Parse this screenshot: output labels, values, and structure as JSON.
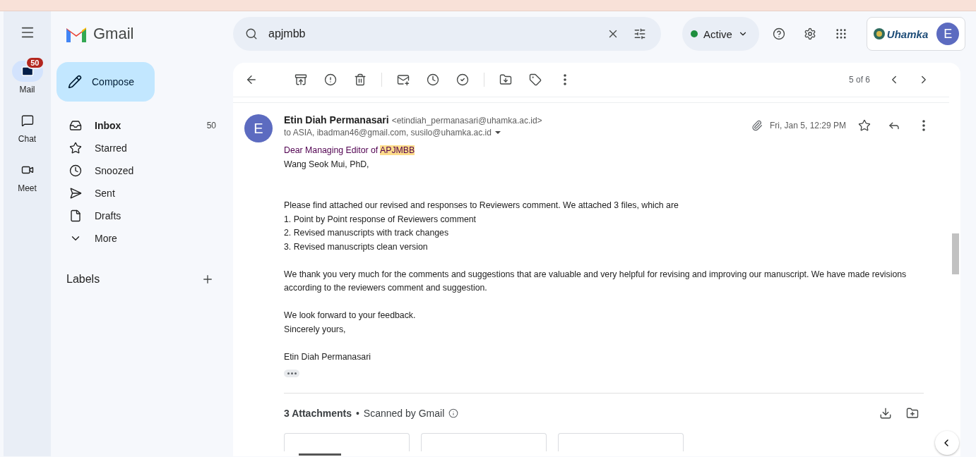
{
  "app": {
    "name": "Gmail"
  },
  "search": {
    "value": "apjmbb"
  },
  "status": {
    "label": "Active"
  },
  "account": {
    "org": "Uhamka",
    "avatar": "E"
  },
  "rail": [
    {
      "label": "Mail",
      "badge": "50",
      "selected": true
    },
    {
      "label": "Chat",
      "selected": false
    },
    {
      "label": "Meet",
      "selected": false
    }
  ],
  "compose": {
    "label": "Compose"
  },
  "nav": [
    {
      "label": "Inbox",
      "count": "50",
      "unread": true
    },
    {
      "label": "Starred",
      "unread": false
    },
    {
      "label": "Snoozed",
      "unread": false
    },
    {
      "label": "Sent",
      "unread": false
    },
    {
      "label": "Drafts",
      "unread": false
    },
    {
      "label": "More",
      "unread": false
    }
  ],
  "labels": {
    "title": "Labels"
  },
  "toolbar": {
    "pager": "5 of 6"
  },
  "message": {
    "avatar": "E",
    "sender": "Etin Diah Permanasari",
    "email": "<etindiah_permanasari@uhamka.ac.id>",
    "recipients": "to ASIA, ibadman46@gmail.com, susilo@uhamka.ac.id",
    "date": "Fri, Jan 5, 12:29 PM",
    "body": [
      {
        "kind": "salutation",
        "text": "Dear Managing Editor of ",
        "match": "APJMBB"
      },
      {
        "kind": "line",
        "text": "Wang Seok Mui, PhD,"
      },
      {
        "kind": "gap"
      },
      {
        "kind": "gap"
      },
      {
        "kind": "line",
        "text": "Please find attached our revised and responses to Reviewers comment. We attached 3 files, which are"
      },
      {
        "kind": "line",
        "text": "1. Point by Point response of Reviewers comment"
      },
      {
        "kind": "line",
        "text": "2. Revised manuscripts with track changes"
      },
      {
        "kind": "line",
        "text": "3. Revised manuscripts clean version"
      },
      {
        "kind": "gap"
      },
      {
        "kind": "line",
        "text": "We thank you very much for the comments and suggestions that are valuable and very helpful for revising and improving our manuscript. We have made revisions according to the reviewers comment and suggestion."
      },
      {
        "kind": "gap"
      },
      {
        "kind": "line",
        "text": "We look forward to your feedback."
      },
      {
        "kind": "line",
        "text": "Sincerely yours,"
      },
      {
        "kind": "gap"
      },
      {
        "kind": "line",
        "text": "Etin Diah Permanasari"
      }
    ],
    "attachments": {
      "title": "3 Attachments",
      "separator": "•",
      "scan": "Scanned by Gmail",
      "thumbnails": [
        {
          "kind": "document"
        },
        {
          "kind": "blank"
        },
        {
          "kind": "blank"
        }
      ]
    }
  }
}
